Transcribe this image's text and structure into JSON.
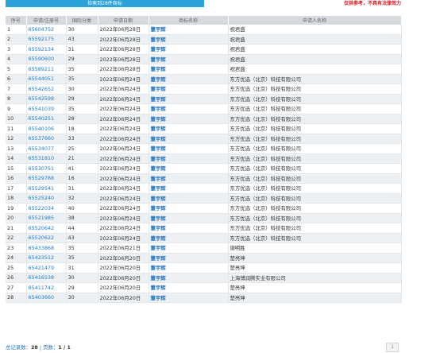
{
  "banner": "检索到28件商标",
  "disclaimer": "仅供参考，不具有法律效力",
  "columns": [
    "序号",
    "申请/注册号",
    "国际分类",
    "申请日期",
    "商标名称",
    "申请人名称"
  ],
  "rows": [
    {
      "no": "1",
      "reg": "65604752",
      "cls": "30",
      "date": "2022年06月28日",
      "mark": "董宇辉",
      "applicant": "祝君盛"
    },
    {
      "no": "2",
      "reg": "65592175",
      "cls": "43",
      "date": "2022年06月28日",
      "mark": "董宇辉",
      "applicant": "祝君盛"
    },
    {
      "no": "3",
      "reg": "65592134",
      "cls": "31",
      "date": "2022年06月28日",
      "mark": "董宇辉",
      "applicant": "祝君盛"
    },
    {
      "no": "4",
      "reg": "65590600",
      "cls": "29",
      "date": "2022年06月28日",
      "mark": "董宇辉",
      "applicant": "祝君盛"
    },
    {
      "no": "5",
      "reg": "65589211",
      "cls": "35",
      "date": "2022年06月28日",
      "mark": "董宇辉",
      "applicant": "祝君盛"
    },
    {
      "no": "6",
      "reg": "65544051",
      "cls": "35",
      "date": "2022年06月24日",
      "mark": "董宇辉",
      "applicant": "东方优选（北京）科技有限公司"
    },
    {
      "no": "7",
      "reg": "65542652",
      "cls": "30",
      "date": "2022年06月24日",
      "mark": "董宇辉",
      "applicant": "东方优选（北京）科技有限公司"
    },
    {
      "no": "8",
      "reg": "65542598",
      "cls": "29",
      "date": "2022年06月24日",
      "mark": "董宇辉",
      "applicant": "东方优选（北京）科技有限公司"
    },
    {
      "no": "9",
      "reg": "65541039",
      "cls": "35",
      "date": "2022年06月24日",
      "mark": "董宇辉",
      "applicant": "东方优选（北京）科技有限公司"
    },
    {
      "no": "10",
      "reg": "65540251",
      "cls": "28",
      "date": "2022年06月24日",
      "mark": "董宇辉",
      "applicant": "东方优选（北京）科技有限公司"
    },
    {
      "no": "11",
      "reg": "65540106",
      "cls": "18",
      "date": "2022年06月24日",
      "mark": "董宇辉",
      "applicant": "东方优选（北京）科技有限公司"
    },
    {
      "no": "12",
      "reg": "65537660",
      "cls": "33",
      "date": "2022年06月24日",
      "mark": "董宇辉",
      "applicant": "东方优选（北京）科技有限公司"
    },
    {
      "no": "13",
      "reg": "65534077",
      "cls": "25",
      "date": "2022年06月24日",
      "mark": "董宇辉",
      "applicant": "东方优选（北京）科技有限公司"
    },
    {
      "no": "14",
      "reg": "65531810",
      "cls": "21",
      "date": "2022年06月24日",
      "mark": "董宇辉",
      "applicant": "东方优选（北京）科技有限公司"
    },
    {
      "no": "15",
      "reg": "65530751",
      "cls": "41",
      "date": "2022年06月24日",
      "mark": "董宇辉",
      "applicant": "东方优选（北京）科技有限公司"
    },
    {
      "no": "16",
      "reg": "65529788",
      "cls": "16",
      "date": "2022年06月24日",
      "mark": "董宇辉",
      "applicant": "东方优选（北京）科技有限公司"
    },
    {
      "no": "17",
      "reg": "65529541",
      "cls": "31",
      "date": "2022年06月24日",
      "mark": "董宇辉",
      "applicant": "东方优选（北京）科技有限公司"
    },
    {
      "no": "18",
      "reg": "65525240",
      "cls": "32",
      "date": "2022年06月24日",
      "mark": "董宇辉",
      "applicant": "东方优选（北京）科技有限公司"
    },
    {
      "no": "19",
      "reg": "65522034",
      "cls": "40",
      "date": "2022年06月24日",
      "mark": "董宇辉",
      "applicant": "东方优选（北京）科技有限公司"
    },
    {
      "no": "20",
      "reg": "65521985",
      "cls": "38",
      "date": "2022年06月24日",
      "mark": "董宇辉",
      "applicant": "东方优选（北京）科技有限公司"
    },
    {
      "no": "21",
      "reg": "65520642",
      "cls": "44",
      "date": "2022年06月24日",
      "mark": "董宇辉",
      "applicant": "东方优选（北京）科技有限公司"
    },
    {
      "no": "22",
      "reg": "65520622",
      "cls": "43",
      "date": "2022年06月24日",
      "mark": "董宇辉",
      "applicant": "东方优选（北京）科技有限公司"
    },
    {
      "no": "23",
      "reg": "65433868",
      "cls": "35",
      "date": "2022年06月21日",
      "mark": "董宇辉",
      "applicant": "谢明胜"
    },
    {
      "no": "24",
      "reg": "65423512",
      "cls": "35",
      "date": "2022年06月20日",
      "mark": "董宇辉",
      "applicant": "楚亮坤"
    },
    {
      "no": "25",
      "reg": "65421479",
      "cls": "31",
      "date": "2022年06月20日",
      "mark": "董宇辉",
      "applicant": "楚亮坤"
    },
    {
      "no": "26",
      "reg": "65416538",
      "cls": "30",
      "date": "2022年06月20日",
      "mark": "董宇辉",
      "applicant": "上海博润腾实业有限公司"
    },
    {
      "no": "27",
      "reg": "65411742",
      "cls": "29",
      "date": "2022年06月20日",
      "mark": "董宇辉",
      "applicant": "楚亮坤"
    },
    {
      "no": "28",
      "reg": "65403660",
      "cls": "30",
      "date": "2022年06月20日",
      "mark": "董宇辉",
      "applicant": "楚亮坤"
    }
  ],
  "footer": {
    "total_label": "总记录数：",
    "total": "28",
    "sep": " | ",
    "pages_label": "页数：",
    "pages": "1 / 1",
    "page_button": "1"
  }
}
